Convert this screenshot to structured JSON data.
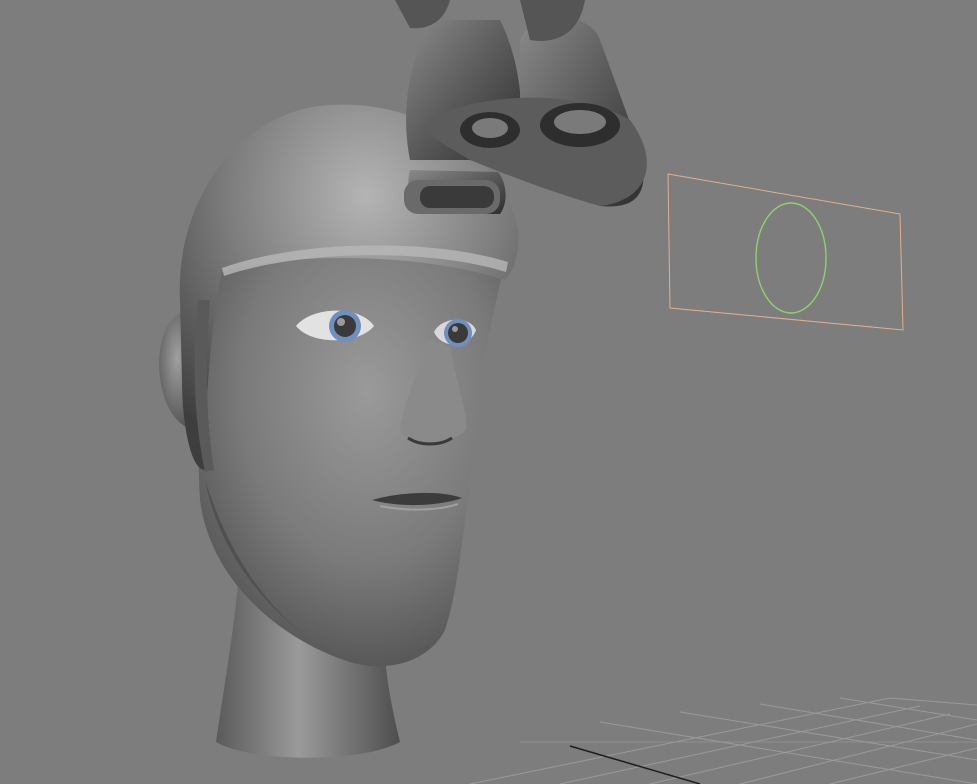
{
  "viewport": {
    "background": "#7d7d7d",
    "grid_color": "#9a9a9a",
    "grid_axis_color": "#1e1e1e",
    "model": {
      "head": "character-head",
      "helmet": "helmet",
      "goggles": "night-vision-goggles",
      "eye_color": "#6f8fbf"
    },
    "control_plane": {
      "frame_color": "#e0b090",
      "control_color": "#8ed16a"
    }
  }
}
